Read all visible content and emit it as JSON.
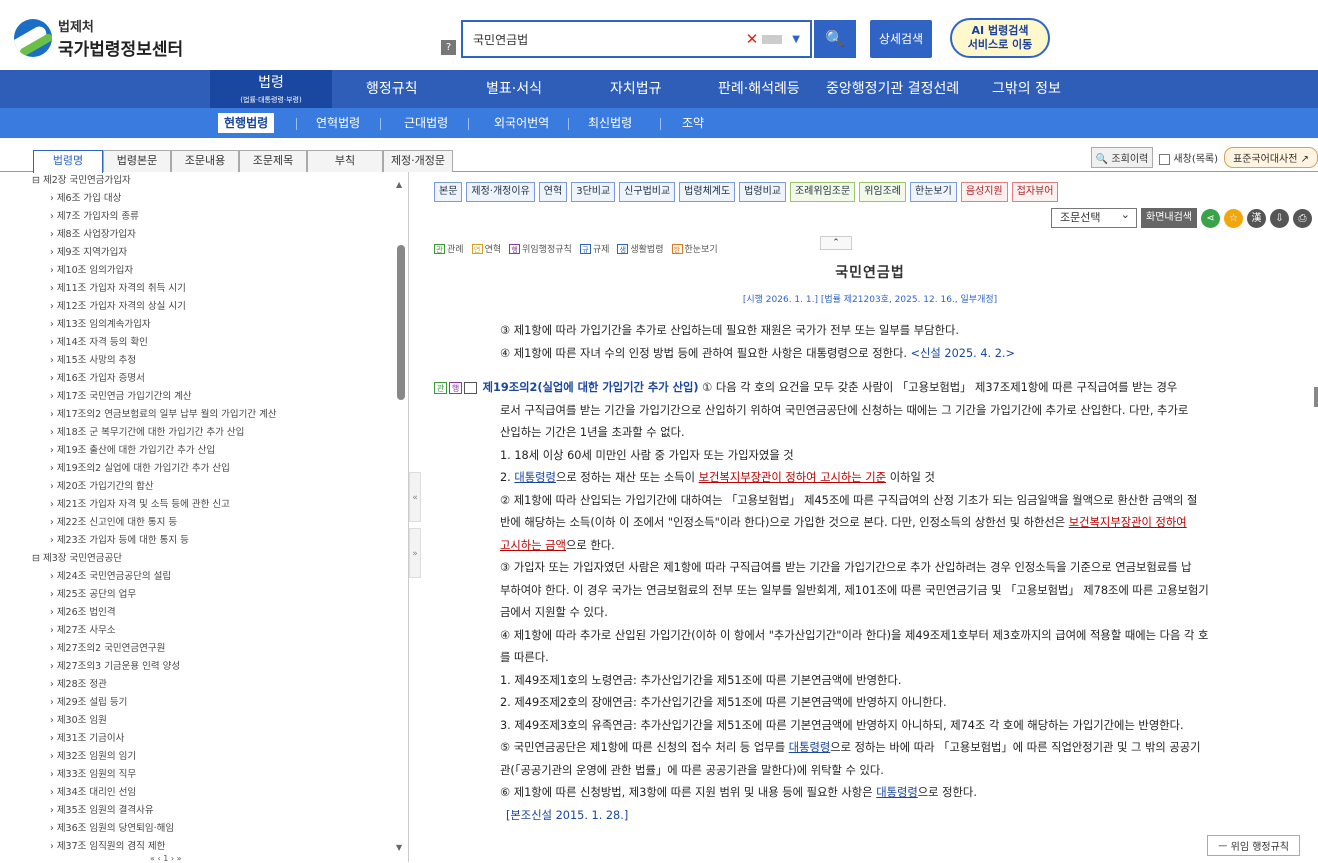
{
  "header": {
    "logo_sub": "법제처",
    "logo_main": "국가법령정보센터",
    "help": "?",
    "search_value": "국민연금법",
    "search_btn": "🔍",
    "advanced": "상세검색",
    "ai_line1": "AI 법령검색",
    "ai_line2": "서비스로 이동"
  },
  "nav1": {
    "active_label": "법령",
    "active_small": "(법률·대통령령·부령)",
    "items": [
      "행정규칙",
      "별표·서식",
      "자치법규",
      "판례·해석례등",
      "중앙행정기관 결정선례",
      "그밖의 정보"
    ]
  },
  "nav2": {
    "items": [
      "현행법령",
      "연혁법령",
      "근대법령",
      "외국어번역",
      "최신법령",
      "조약"
    ]
  },
  "tabs": [
    "법령명",
    "법령본문",
    "조문내용",
    "조문제목",
    "부칙",
    "제정·개정문"
  ],
  "tools": {
    "history": "조회이력",
    "new_window": "새창(목록)",
    "dictionary": "표준국어대사전"
  },
  "tree": [
    {
      "t": "chapter",
      "label": "⊟ 제2장 국민연금가입자"
    },
    {
      "t": "article",
      "label": "› 제6조 가입 대상"
    },
    {
      "t": "article",
      "label": "› 제7조 가입자의 종류"
    },
    {
      "t": "article",
      "label": "› 제8조 사업장가입자"
    },
    {
      "t": "article",
      "label": "› 제9조 지역가입자"
    },
    {
      "t": "article",
      "label": "› 제10조 임의가입자"
    },
    {
      "t": "article",
      "label": "› 제11조 가입자 자격의 취득 시기"
    },
    {
      "t": "article",
      "label": "› 제12조 가입자 자격의 상실 시기"
    },
    {
      "t": "article",
      "label": "› 제13조 임의계속가입자"
    },
    {
      "t": "article",
      "label": "› 제14조 자격 등의 확인"
    },
    {
      "t": "article",
      "label": "› 제15조 사망의 추정"
    },
    {
      "t": "article",
      "label": "› 제16조 가입자 증명서"
    },
    {
      "t": "article",
      "label": "› 제17조 국민연금 가입기간의 계산"
    },
    {
      "t": "article",
      "label": "› 제17조의2 연금보험료의 일부 납부 월의 가입기간 계산"
    },
    {
      "t": "article",
      "label": "› 제18조 군 복무기간에 대한 가입기간 추가 산입"
    },
    {
      "t": "article",
      "label": "› 제19조 출산에 대한 가입기간 추가 산입"
    },
    {
      "t": "article",
      "label": "› 제19조의2 실업에 대한 가입기간 추가 산입"
    },
    {
      "t": "article",
      "label": "› 제20조 가입기간의 합산"
    },
    {
      "t": "article",
      "label": "› 제21조 가입자 자격 및 소득 등에 관한 신고"
    },
    {
      "t": "article",
      "label": "› 제22조 신고인에 대한 통지 등"
    },
    {
      "t": "article",
      "label": "› 제23조 가입자 등에 대한 통지 등"
    },
    {
      "t": "chapter",
      "label": "⊟ 제3장 국민연금공단"
    },
    {
      "t": "article",
      "label": "› 제24조 국민연금공단의 설립"
    },
    {
      "t": "article",
      "label": "› 제25조 공단의 업무"
    },
    {
      "t": "article",
      "label": "› 제26조 법인격"
    },
    {
      "t": "article",
      "label": "› 제27조 사무소"
    },
    {
      "t": "article",
      "label": "› 제27조의2 국민연금연구원"
    },
    {
      "t": "article",
      "label": "› 제27조의3 기금운용 인력 양성"
    },
    {
      "t": "article",
      "label": "› 제28조 정관"
    },
    {
      "t": "article",
      "label": "› 제29조 설립 등기"
    },
    {
      "t": "article",
      "label": "› 제30조 임원"
    },
    {
      "t": "article",
      "label": "› 제31조 기금이사"
    },
    {
      "t": "article",
      "label": "› 제32조 임원의 임기"
    },
    {
      "t": "article",
      "label": "› 제33조 임원의 직무"
    },
    {
      "t": "article",
      "label": "› 제34조 대리인 선임"
    },
    {
      "t": "article",
      "label": "› 제35조 임원의 결격사유"
    },
    {
      "t": "article",
      "label": "› 제36조 임원의 당연퇴임·해임"
    },
    {
      "t": "article",
      "label": "› 제37조 임직원의 겸직 제한"
    }
  ],
  "buttons1": [
    "본문",
    "제정·개정이유",
    "연혁",
    "3단비교",
    "신구법비교",
    "법령체계도",
    "법령비교",
    "조례위임조문",
    "위임조례",
    "한눈보기",
    "음성지원",
    "접자뷰어"
  ],
  "article_select": "조문선택",
  "screen_search": "화면내검색",
  "legend": [
    {
      "tag": "관",
      "label": "관례"
    },
    {
      "tag": "연",
      "label": "연혁"
    },
    {
      "tag": "행",
      "label": "위임행정규칙"
    },
    {
      "tag": "규",
      "label": "규제"
    },
    {
      "tag": "생",
      "label": "생활법령"
    },
    {
      "tag": "한",
      "label": "한눈보기"
    }
  ],
  "law": {
    "title": "국민연금법",
    "subtitle": "[시행 2026. 1. 1.] [법률 제21203호, 2025. 12. 16., 일부개정]",
    "l1": "③ 제1항에 따라 가입기간을 추가로 산입하는데 필요한 재원은 국가가 전부 또는 일부를 부담한다.",
    "l2a": "④ 제1항에 따른 자녀 수의 인정 방법 등에 관하여 필요한 사항은 대통령령으로 정한다. ",
    "l2b": "<신설 2025. 4. 2.>",
    "art_head": "제19조의2(실업에 대한 가입기간 추가 산입)",
    "art_1": " ① 다음 각 호의 요건을 모두 갖춘 사람이 「고용보험법」 제37조제1항에 따른 구직급여를 받는 경우",
    "art_2": "로서 구직급여를 받는 기간을 가입기간으로 산입하기 위하여 국민연금공단에 신청하는 때에는 그 기간을 가입기간에 추가로 산입한다. 다만, 추가로",
    "art_3": "산입하는 기간은 1년을 초과할 수 없다.",
    "art_4": "1. 18세 이상 60세 미만인 사람 중 가입자 또는 가입자였을 것",
    "art_5a": "2. ",
    "art_5b": "대통령령",
    "art_5c": "으로 정하는 재산 또는 소득이 ",
    "art_5d": "보건복지부장관이 정하여 고시하는 기준",
    "art_5e": " 이하일 것",
    "art_6": "② 제1항에 따라 산입되는 가입기간에 대하여는 「고용보험법」 제45조에 따른 구직급여의 산정 기초가 되는 임금일액을 월액으로 환산한 금액의 절",
    "art_7a": "반에 해당하는 소득(이하 이 조에서 \"인정소득\"이라 한다)으로 가입한 것으로 본다. 다만, 인정소득의 상한선 및 하한선은 ",
    "art_7b": "보건복지부장관이 정하여",
    "art_8a": "고시하는 금액",
    "art_8b": "으로 한다.",
    "art_9": "③ 가입자 또는 가입자였던 사람은 제1항에 따라 구직급여를 받는 기간을 가입기간으로 추가 산입하려는 경우 인정소득을 기준으로 연금보험료를 납",
    "art_10": "부하여야 한다. 이 경우 국가는 연금보험료의 전부 또는 일부를 일반회계, 제101조에 따른 국민연금기금 및 「고용보험법」 제78조에 따른 고용보험기",
    "art_11": "금에서 지원할 수 있다.",
    "art_12": "④ 제1항에 따라 추가로 산입된 가입기간(이하 이 항에서 \"추가산입기간\"이라 한다)을 제49조제1호부터 제3호까지의 급여에 적용할 때에는 다음 각 호",
    "art_13": "를 따른다.",
    "art_14": "1. 제49조제1호의 노령연금: 추가산입기간을 제51조에 따른 기본연금액에 반영한다.",
    "art_15": "2. 제49조제2호의 장애연금: 추가산입기간을 제51조에 따른 기본연금액에 반영하지 아니한다.",
    "art_16": "3. 제49조제3호의 유족연금: 추가산입기간을 제51조에 따른 기본연금액에 반영하지 아니하되, 제74조 각 호에 해당하는 가입기간에는 반영한다.",
    "art_17a": "⑤ 국민연금공단은 제1항에 따른 신청의 접수 처리 등 업무를 ",
    "art_17b": "대통령령",
    "art_17c": "으로 정하는 바에 따라 「고용보험법」에 따른 직업안정기관 및 그 밖의 공공기",
    "art_18": "관(「공공기관의 운영에 관한 법률」에 따른 공공기관을 말한다)에 위탁할 수 있다.",
    "art_19a": "⑥ 제1항에 따른 신청방법, 제3항에 따른 지원 범위 및 내용 등에 필요한 사항은 ",
    "art_19b": "대통령령",
    "art_19c": "으로 정한다.",
    "art_20": "[본조신설 2015. 1. 28.]"
  },
  "delegate": "ㅡ 위임 행정규칙",
  "pager_page": "1"
}
